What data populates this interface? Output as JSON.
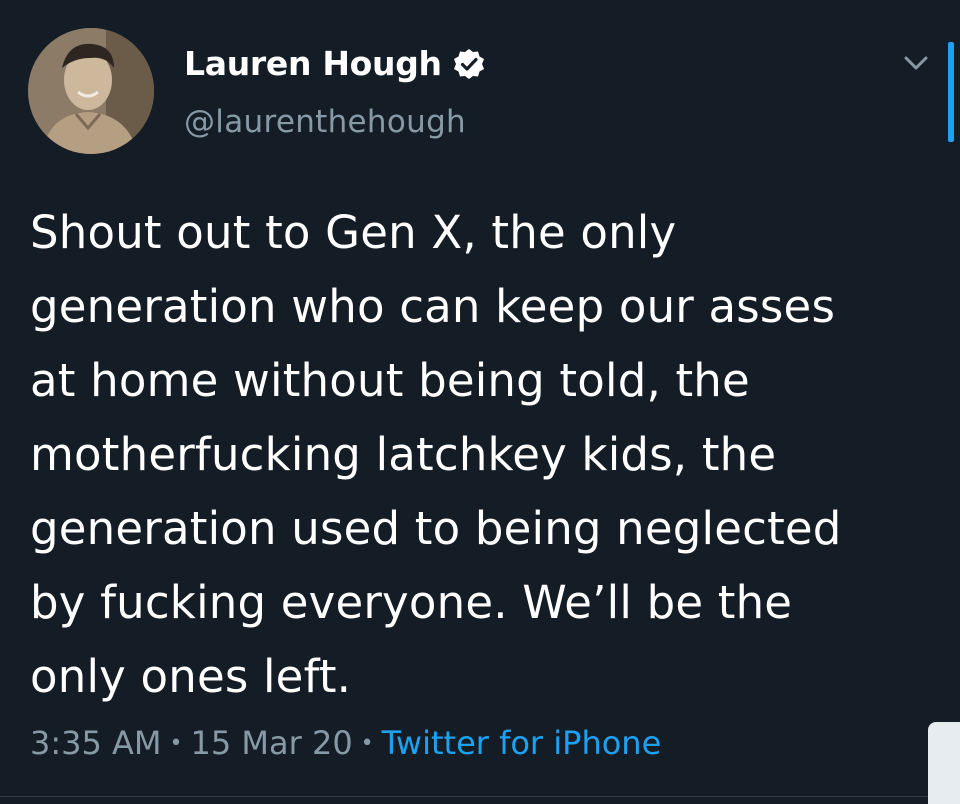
{
  "tweet": {
    "author": {
      "display_name": "Lauren Hough",
      "handle": "@laurenthehough",
      "verified": true
    },
    "text": "Shout out to Gen X, the only\ngeneration who can keep our asses\nat home without being told, the\nmotherfucking latchkey kids, the\ngeneration used to being neglected\nby fucking everyone. We’ll be the\nonly ones left.",
    "time": "3:35 AM",
    "date": "15 Mar 20",
    "separator": "•",
    "source": "Twitter for iPhone"
  },
  "icons": {
    "verified": "verified-badge-icon",
    "menu": "chevron-down-icon"
  },
  "colors": {
    "background": "#141d26",
    "text": "#ffffff",
    "secondary": "#8899a6",
    "accent": "#1da1f2"
  }
}
